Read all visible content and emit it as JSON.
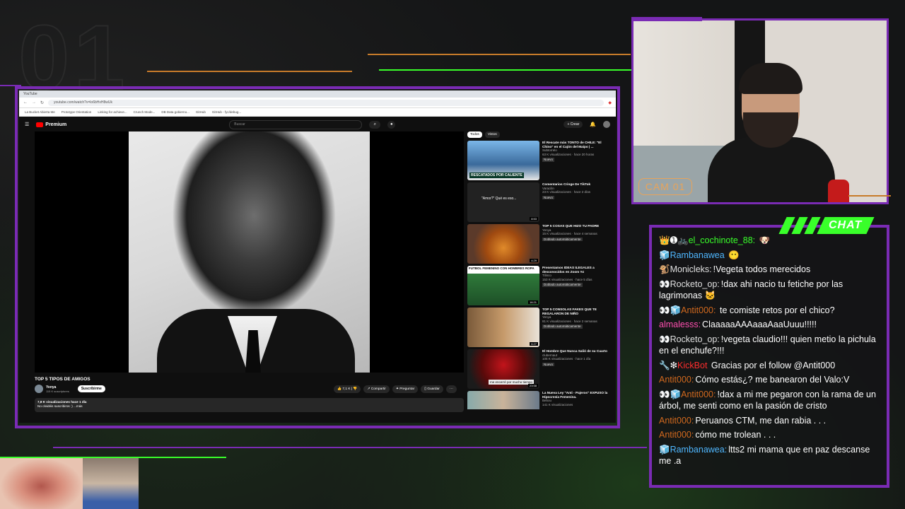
{
  "overlay": {
    "corner_number": "01",
    "cam_label": "CAM 01",
    "chat_title": "CHAT"
  },
  "browser": {
    "tab_label": "YouTube",
    "url": "youtube.com/watch?v=lo6bHxH8wUk",
    "bookmarks": [
      "La Bucket Abierta Me",
      "Prototype Orientation",
      "Linking for achieve...",
      "Crunch Mode...",
      "DB Data gobierno...",
      "GitHub",
      "GitHub - fyc/debug..."
    ]
  },
  "youtube": {
    "logo_text": "Premium",
    "search_placeholder": "Buscar",
    "create_label": "+ Crear",
    "video_title": "TOP 5 TIPOS DE AMIGOS",
    "channel_name": "Yenya",
    "channel_subs": "115 K suscriptores",
    "subscribe_label": "Suscribirme",
    "likes": "7,1 K",
    "share_label": "Compartir",
    "ask_label": "Preguntar",
    "save_label": "Guardar",
    "desc_line1": "7,8 K visualizaciones  hace 1 día",
    "desc_line2": "No olvidéis suscribiros :) ...más",
    "chips": [
      "Todos",
      "Vistos"
    ],
    "recommendations": [
      {
        "title": "El Rescate más TONTO de CHILE: \"El Chino\" en el Cajón del Maipo | ...",
        "channel": "Subtorrelo",
        "meta": "63 K visualizaciones · hace 20 horas",
        "badge": "Nuevo",
        "duration": "",
        "thumb_text": "RESCATADOS POR CALIENTE"
      },
      {
        "title": "Comentarios Cringe De TikTok",
        "channel": "Varacilin",
        "meta": "23 K visualizaciones · hace 2 días",
        "badge": "Nuevo",
        "duration": "8:53",
        "thumb_text": "\"Amor?\" Qué es eso..."
      },
      {
        "title": "TOP 5 COSAS QUE HIZO TU PADRE",
        "channel": "Yenya",
        "meta": "15 K visualizaciones · hace 4 semanas",
        "badge": "Doblado automáticamente",
        "duration": "4:29",
        "thumb_text": ""
      },
      {
        "title": "Presentamos IDEAS ILEGALES a desconocidos en Zoom #4",
        "channel": "Tilinco",
        "meta": "153 K visualizaciones · hace 5 días",
        "badge": "Doblado automáticamente",
        "duration": "16:21",
        "thumb_text": "FUTBOL FEMENINO CON HOMBRES ROPA"
      },
      {
        "title": "TOP 5 CONSOLAS FAKES QUE TE REGALARON DE NIÑO",
        "channel": "Yenya",
        "meta": "81 K visualizaciones · hace 2 semanas",
        "badge": "Doblado automáticamente",
        "duration": "6:27",
        "thumb_text": ""
      },
      {
        "title": "El Hombre Que Nunca Salió de su Cuarto",
        "channel": "clubernaut",
        "meta": "105 K visualizaciones · hace 1 día",
        "badge": "Nuevo",
        "duration": "23:58",
        "thumb_text": "me encerré por mucho tiempo"
      },
      {
        "title": "La Nueva Ley \"Anti - Pajeros\" EXPUSO la Hipocresía Femenina.",
        "channel": "Bebou",
        "meta": "141 K visualizaciones",
        "badge": "",
        "duration": "",
        "thumb_text": ""
      }
    ]
  },
  "chat": {
    "messages": [
      {
        "user": "el_cochinote_88:",
        "user_color": "#39ff2a",
        "badges": "👑➊🚲",
        "text": ""
      },
      {
        "user": "Rambanawea",
        "user_color": "#4fb7ff",
        "badges": "🧊",
        "text": ""
      },
      {
        "user": "Monicleks:",
        "user_color": "#e0e0e0",
        "badges": "🐒",
        "text": "!Vegeta todos merecidos"
      },
      {
        "user": "Rocketo_op:",
        "user_color": "#e0e0e0",
        "badges": "👀",
        "text": "!dax ahi nacio tu fetiche por las lagrimonas"
      },
      {
        "user": "Antit000:",
        "user_color": "#d2691e",
        "badges": "👀🧊",
        "text": "te comiste retos por el chico?"
      },
      {
        "user": "almalesss:",
        "user_color": "#ff4fb0",
        "badges": "",
        "text": "ClaaaaaAAAaaaAaaUuuu!!!!!"
      },
      {
        "user": "Rocketo_op:",
        "user_color": "#e0e0e0",
        "badges": "👀",
        "text": "!vegeta claudio!!! quien metio la pichula en el enchufe?!!!"
      },
      {
        "user": "KickBot",
        "user_color": "#ff2d2d",
        "badges": "🔧❇",
        "text": "Gracias por el follow @Antit000"
      },
      {
        "user": "Antit000:",
        "user_color": "#d2691e",
        "badges": "",
        "text": "Cómo estás¿? me banearon del Valo:V"
      },
      {
        "user": "Antit000:",
        "user_color": "#d2691e",
        "badges": "👀🧊",
        "text": "!dax a mi me pegaron con la rama de un árbol, me senti como en la pasión de cristo"
      },
      {
        "user": "Antit000:",
        "user_color": "#d2691e",
        "badges": "",
        "text": "Peruanos CTM, me dan rabia . . ."
      },
      {
        "user": "Antit000:",
        "user_color": "#d2691e",
        "badges": "",
        "text": "cómo me trolean . . ."
      },
      {
        "user": "Rambanawea:",
        "user_color": "#4fb7ff",
        "badges": "🧊",
        "text": "ltts2 mi mama que en paz descanse me .a"
      }
    ]
  }
}
